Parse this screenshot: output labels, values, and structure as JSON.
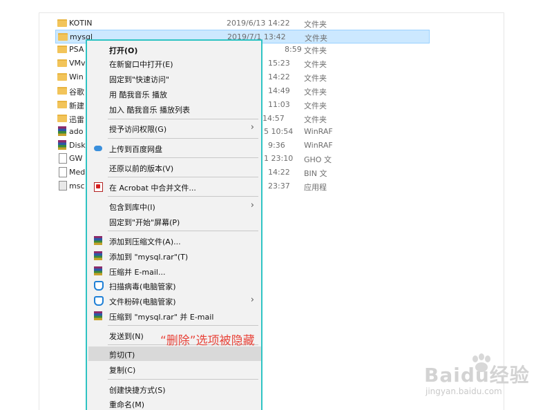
{
  "files": [
    {
      "name": "KOTIN",
      "date": "2019/6/13 14:22",
      "type": "文件夹",
      "icon": "folder-icon"
    },
    {
      "name": "mysql",
      "date": "2019/7/1 13:42",
      "type": "文件夹",
      "icon": "folder-icon",
      "selected": true
    },
    {
      "name": "PSA",
      "date": "8:59",
      "type": "文件夹",
      "icon": "folder-icon"
    },
    {
      "name": "VMv",
      "date": "15:23",
      "type": "文件夹",
      "icon": "folder-icon"
    },
    {
      "name": "Win",
      "date": "14:22",
      "type": "文件夹",
      "icon": "folder-icon"
    },
    {
      "name": "谷歌",
      "date": "14:49",
      "type": "文件夹",
      "icon": "folder-icon"
    },
    {
      "name": "新建",
      "date": "11:03",
      "type": "文件夹",
      "icon": "folder-icon"
    },
    {
      "name": "迅雷",
      "date": "14:57",
      "type": "文件夹",
      "icon": "folder-icon"
    },
    {
      "name": "ado",
      "date": "5 10:54",
      "type": "WinRAF",
      "icon": "rar-icon"
    },
    {
      "name": "Disk",
      "date": "9:36",
      "type": "WinRAF",
      "icon": "rar-icon"
    },
    {
      "name": "GW",
      "date": "1 23:10",
      "type": "GHO 文",
      "icon": "doc-icon"
    },
    {
      "name": "Med",
      "date": "14:22",
      "type": "BIN 文",
      "icon": "doc-icon"
    },
    {
      "name": "msc",
      "date": "23:37",
      "type": "应用程",
      "icon": "exe-icon"
    }
  ],
  "menu": {
    "open": "打开(O)",
    "open_new_window": "在新窗口中打开(E)",
    "pin_quick_access": "固定到\"快速访问\"",
    "play_kugou": "用 酷我音乐 播放",
    "add_kugou_playlist": "加入 酷我音乐 播放列表",
    "grant_access": "授予访问权限(G)",
    "upload_baidu": "上传到百度网盘",
    "restore_previous": "还原以前的版本(V)",
    "acrobat_merge": "在 Acrobat 中合并文件...",
    "include_library": "包含到库中(I)",
    "pin_start": "固定到\"开始\"屏幕(P)",
    "add_archive": "添加到压缩文件(A)...",
    "add_mysql_rar": "添加到 \"mysql.rar\"(T)",
    "compress_email": "压缩并 E-mail...",
    "scan_virus": "扫描病毒(电脑管家)",
    "shred_file": "文件粉碎(电脑管家)",
    "compress_mysql_email": "压缩到 \"mysql.rar\" 并 E-mail",
    "send_to": "发送到(N)",
    "cut": "剪切(T)",
    "copy": "复制(C)",
    "create_shortcut": "创建快捷方式(S)",
    "rename": "重命名(M)"
  },
  "annotation": "“删除”选项被隐藏",
  "watermark": {
    "brand": "Baidu经验",
    "url": "jingyan.baidu.com"
  },
  "colors": {
    "menu_border": "#2ec3c3",
    "annotation": "#e8443a",
    "selection": "#cce8ff"
  }
}
